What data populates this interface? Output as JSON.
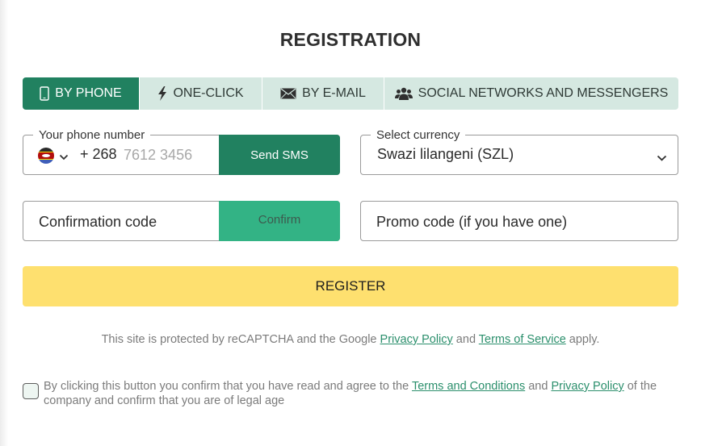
{
  "page": {
    "title": "REGISTRATION"
  },
  "tabs": [
    {
      "label": "BY PHONE",
      "icon": "phone-icon",
      "active": true
    },
    {
      "label": "ONE-CLICK",
      "icon": "lightning-icon",
      "active": false
    },
    {
      "label": "BY E-MAIL",
      "icon": "envelope-icon",
      "active": false
    },
    {
      "label": "SOCIAL NETWORKS AND MESSENGERS",
      "icon": "users-icon",
      "active": false
    }
  ],
  "phone": {
    "legend": "Your phone number",
    "country_flag": "eswatini-flag",
    "dial_code": "+ 268",
    "placeholder": "7612 3456",
    "value": "",
    "send_label": "Send SMS"
  },
  "currency": {
    "legend": "Select currency",
    "selected": "Swazi lilangeni (SZL)"
  },
  "confirmation": {
    "placeholder": "Confirmation code",
    "confirm_label": "Confirm"
  },
  "promo": {
    "placeholder": "Promo code (if you have one)"
  },
  "register_label": "REGISTER",
  "recaptcha": {
    "prefix": "This site is protected by reCAPTCHA and the Google ",
    "privacy_link": "Privacy Policy",
    "middle": " and ",
    "terms_link": "Terms of Service",
    "suffix": " apply."
  },
  "agreement": {
    "checked": false,
    "prefix": "By clicking this button you confirm that you have read and agree to the ",
    "terms_link": "Terms and Conditions",
    "middle": " and ",
    "privacy_link": "Privacy Policy",
    "suffix": " of the company and confirm that you are of legal age"
  },
  "colors": {
    "primary_green": "#218160",
    "confirm_green": "#33b385",
    "tab_inactive": "#d5e8e1",
    "register_yellow": "#fee06f",
    "link_green": "#2b8f6c"
  }
}
